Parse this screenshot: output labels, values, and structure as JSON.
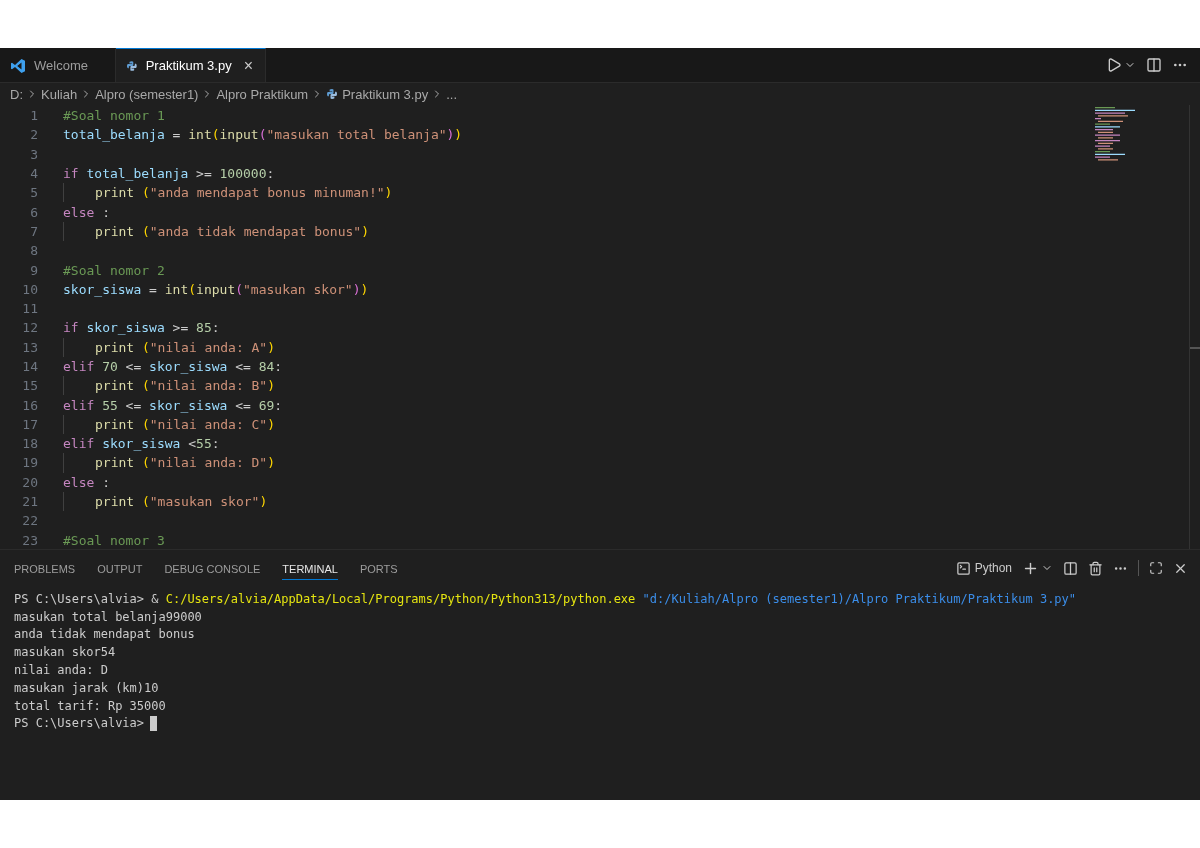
{
  "tabs": [
    {
      "label": "Welcome",
      "kind": "welcome",
      "selected": false
    },
    {
      "label": "Praktikum 3.py",
      "kind": "python",
      "selected": true,
      "close": "×"
    }
  ],
  "breadcrumbs": [
    {
      "label": "D:",
      "kind": "folder"
    },
    {
      "label": "Kuliah",
      "kind": "folder"
    },
    {
      "label": "Alpro (semester1)",
      "kind": "folder"
    },
    {
      "label": "Alpro Praktikum",
      "kind": "folder"
    },
    {
      "label": "Praktikum 3.py",
      "kind": "python"
    },
    {
      "label": "...",
      "kind": "more"
    }
  ],
  "code": [
    {
      "number": "1",
      "indented": false,
      "tokens": [
        {
          "text": "#Soal nomor 1",
          "kind": "comment"
        }
      ]
    },
    {
      "number": "2",
      "indented": false,
      "tokens": [
        {
          "text": "total_belanja",
          "kind": "variable"
        },
        {
          "text": " = ",
          "kind": "plain"
        },
        {
          "text": "int",
          "kind": "function"
        },
        {
          "text": "(",
          "kind": "bracket1"
        },
        {
          "text": "input",
          "kind": "function"
        },
        {
          "text": "(",
          "kind": "bracket2"
        },
        {
          "text": "\"masukan total belanja\"",
          "kind": "string"
        },
        {
          "text": ")",
          "kind": "bracket2"
        },
        {
          "text": ")",
          "kind": "bracket1"
        }
      ]
    },
    {
      "number": "3",
      "indented": false
    },
    {
      "number": "4",
      "indented": false,
      "tokens": [
        {
          "text": "if ",
          "kind": "keyword"
        },
        {
          "text": "total_belanja",
          "kind": "variable"
        },
        {
          "text": " >= ",
          "kind": "plain"
        },
        {
          "text": "100000",
          "kind": "number"
        },
        {
          "text": ":",
          "kind": "plain"
        }
      ]
    },
    {
      "number": "5",
      "indented": true,
      "tokens": [
        {
          "text": "print ",
          "kind": "function"
        },
        {
          "text": "(",
          "kind": "bracket1"
        },
        {
          "text": "\"anda mendapat bonus minuman!\"",
          "kind": "string"
        },
        {
          "text": ")",
          "kind": "bracket1"
        }
      ]
    },
    {
      "number": "6",
      "indented": false,
      "tokens": [
        {
          "text": "else",
          "kind": "keyword"
        },
        {
          "text": " :",
          "kind": "plain"
        }
      ]
    },
    {
      "number": "7",
      "indented": true,
      "tokens": [
        {
          "text": "print ",
          "kind": "function"
        },
        {
          "text": "(",
          "kind": "bracket1"
        },
        {
          "text": "\"anda tidak mendapat bonus\"",
          "kind": "string"
        },
        {
          "text": ")",
          "kind": "bracket1"
        }
      ]
    },
    {
      "number": "8",
      "indented": false
    },
    {
      "number": "9",
      "indented": false,
      "tokens": [
        {
          "text": "#Soal nomor 2",
          "kind": "comment"
        }
      ]
    },
    {
      "number": "10",
      "indented": false,
      "tokens": [
        {
          "text": "skor_siswa",
          "kind": "variable"
        },
        {
          "text": " = ",
          "kind": "plain"
        },
        {
          "text": "int",
          "kind": "function"
        },
        {
          "text": "(",
          "kind": "bracket1"
        },
        {
          "text": "input",
          "kind": "function"
        },
        {
          "text": "(",
          "kind": "bracket2"
        },
        {
          "text": "\"masukan skor\"",
          "kind": "string"
        },
        {
          "text": ")",
          "kind": "bracket2"
        },
        {
          "text": ")",
          "kind": "bracket1"
        }
      ]
    },
    {
      "number": "11",
      "indented": false
    },
    {
      "number": "12",
      "indented": false,
      "tokens": [
        {
          "text": "if ",
          "kind": "keyword"
        },
        {
          "text": "skor_siswa",
          "kind": "variable"
        },
        {
          "text": " >= ",
          "kind": "plain"
        },
        {
          "text": "85",
          "kind": "number"
        },
        {
          "text": ":",
          "kind": "plain"
        }
      ]
    },
    {
      "number": "13",
      "indented": true,
      "tokens": [
        {
          "text": "print ",
          "kind": "function"
        },
        {
          "text": "(",
          "kind": "bracket1"
        },
        {
          "text": "\"nilai anda: A\"",
          "kind": "string"
        },
        {
          "text": ")",
          "kind": "bracket1"
        }
      ]
    },
    {
      "number": "14",
      "indented": false,
      "tokens": [
        {
          "text": "elif ",
          "kind": "keyword"
        },
        {
          "text": "70",
          "kind": "number"
        },
        {
          "text": " <= ",
          "kind": "plain"
        },
        {
          "text": "skor_siswa",
          "kind": "variable"
        },
        {
          "text": " <= ",
          "kind": "plain"
        },
        {
          "text": "84",
          "kind": "number"
        },
        {
          "text": ":",
          "kind": "plain"
        }
      ]
    },
    {
      "number": "15",
      "indented": true,
      "tokens": [
        {
          "text": "print ",
          "kind": "function"
        },
        {
          "text": "(",
          "kind": "bracket1"
        },
        {
          "text": "\"nilai anda: B\"",
          "kind": "string"
        },
        {
          "text": ")",
          "kind": "bracket1"
        }
      ]
    },
    {
      "number": "16",
      "indented": false,
      "tokens": [
        {
          "text": "elif ",
          "kind": "keyword"
        },
        {
          "text": "55",
          "kind": "number"
        },
        {
          "text": " <= ",
          "kind": "plain"
        },
        {
          "text": "skor_siswa",
          "kind": "variable"
        },
        {
          "text": " <= ",
          "kind": "plain"
        },
        {
          "text": "69",
          "kind": "number"
        },
        {
          "text": ":",
          "kind": "plain"
        }
      ]
    },
    {
      "number": "17",
      "indented": true,
      "tokens": [
        {
          "text": "print ",
          "kind": "function"
        },
        {
          "text": "(",
          "kind": "bracket1"
        },
        {
          "text": "\"nilai anda: C\"",
          "kind": "string"
        },
        {
          "text": ")",
          "kind": "bracket1"
        }
      ]
    },
    {
      "number": "18",
      "indented": false,
      "tokens": [
        {
          "text": "elif ",
          "kind": "keyword"
        },
        {
          "text": "skor_siswa",
          "kind": "variable"
        },
        {
          "text": " <",
          "kind": "plain"
        },
        {
          "text": "55",
          "kind": "number"
        },
        {
          "text": ":",
          "kind": "plain"
        }
      ]
    },
    {
      "number": "19",
      "indented": true,
      "tokens": [
        {
          "text": "print ",
          "kind": "function"
        },
        {
          "text": "(",
          "kind": "bracket1"
        },
        {
          "text": "\"nilai anda: D\"",
          "kind": "string"
        },
        {
          "text": ")",
          "kind": "bracket1"
        }
      ]
    },
    {
      "number": "20",
      "indented": false,
      "tokens": [
        {
          "text": "else",
          "kind": "keyword"
        },
        {
          "text": " :",
          "kind": "plain"
        }
      ]
    },
    {
      "number": "21",
      "indented": true,
      "tokens": [
        {
          "text": "print ",
          "kind": "function"
        },
        {
          "text": "(",
          "kind": "bracket1"
        },
        {
          "text": "\"masukan skor\"",
          "kind": "string"
        },
        {
          "text": ")",
          "kind": "bracket1"
        }
      ]
    },
    {
      "number": "22",
      "indented": false
    },
    {
      "number": "23",
      "indented": false,
      "tokens": [
        {
          "text": "#Soal nomor 3",
          "kind": "comment"
        }
      ]
    }
  ],
  "panel": {
    "tabs": [
      {
        "label": "PROBLEMS",
        "selected": false
      },
      {
        "label": "OUTPUT",
        "selected": false
      },
      {
        "label": "DEBUG CONSOLE",
        "selected": false
      },
      {
        "label": "TERMINAL",
        "selected": true
      },
      {
        "label": "PORTS",
        "selected": false
      }
    ],
    "shell": "Python"
  },
  "terminal": [
    {
      "tokens": [
        {
          "text": "PS C:\\Users\\alvia> & ",
          "kind": "plain"
        },
        {
          "text": "C:/Users/alvia/AppData/Local/Programs/Python/Python313/python.exe",
          "kind": "path"
        },
        {
          "text": " \"d:/Kuliah/Alpro (semester1)/Alpro Praktikum/Praktikum 3.py\"",
          "kind": "argument"
        }
      ]
    },
    {
      "tokens": [
        {
          "text": "masukan total belanja99000",
          "kind": "plain"
        }
      ]
    },
    {
      "tokens": [
        {
          "text": "anda tidak mendapat bonus",
          "kind": "plain"
        }
      ]
    },
    {
      "tokens": [
        {
          "text": "masukan skor54",
          "kind": "plain"
        }
      ]
    },
    {
      "tokens": [
        {
          "text": "nilai anda: D",
          "kind": "plain"
        }
      ]
    },
    {
      "tokens": [
        {
          "text": "masukan jarak (km)10",
          "kind": "plain"
        }
      ]
    },
    {
      "tokens": [
        {
          "text": "total tarif: Rp 35000",
          "kind": "plain"
        }
      ]
    },
    {
      "tokens": [
        {
          "text": "PS C:\\Users\\alvia>",
          "kind": "plain"
        }
      ],
      "cursor": true
    }
  ]
}
